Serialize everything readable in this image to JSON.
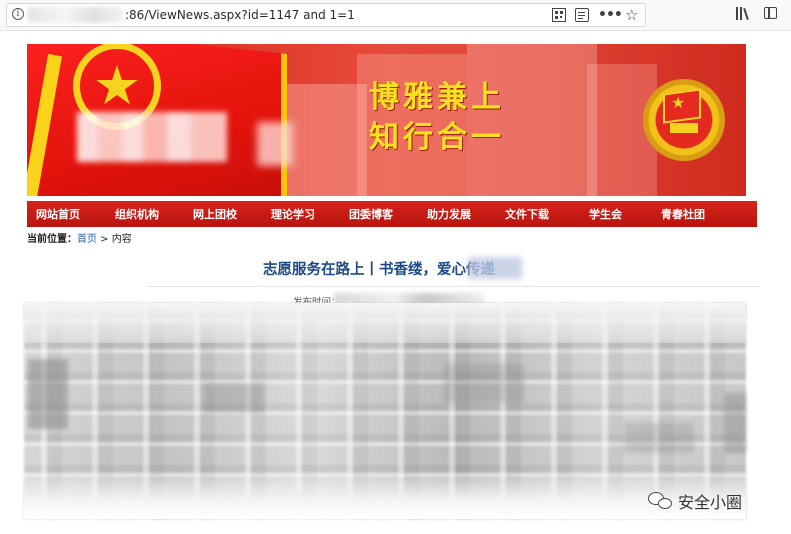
{
  "browser": {
    "url": ":86/ViewNews.aspx?id=1147 and 1=1"
  },
  "banner": {
    "motto_line1": "博雅兼上",
    "motto_line2": "知行合一"
  },
  "nav": {
    "items": [
      "网站首页",
      "组织机构",
      "网上团校",
      "理论学习",
      "团委博客",
      "助力发展",
      "文件下载",
      "学生会",
      "青春社团"
    ]
  },
  "breadcrumb": {
    "label": "当前位置：",
    "home": "首页",
    "separator": " > ",
    "current": "内容"
  },
  "article": {
    "title": "志愿服务在路上丨书香缕",
    "title_tail": "，爱心传递",
    "meta_prefix": "发布时间：20"
  },
  "watermark": {
    "text": "安全小圈"
  },
  "colors": {
    "nav_red": "#c41a13",
    "title_blue": "#1d4a86",
    "motto_yellow": "#f6e11c"
  }
}
